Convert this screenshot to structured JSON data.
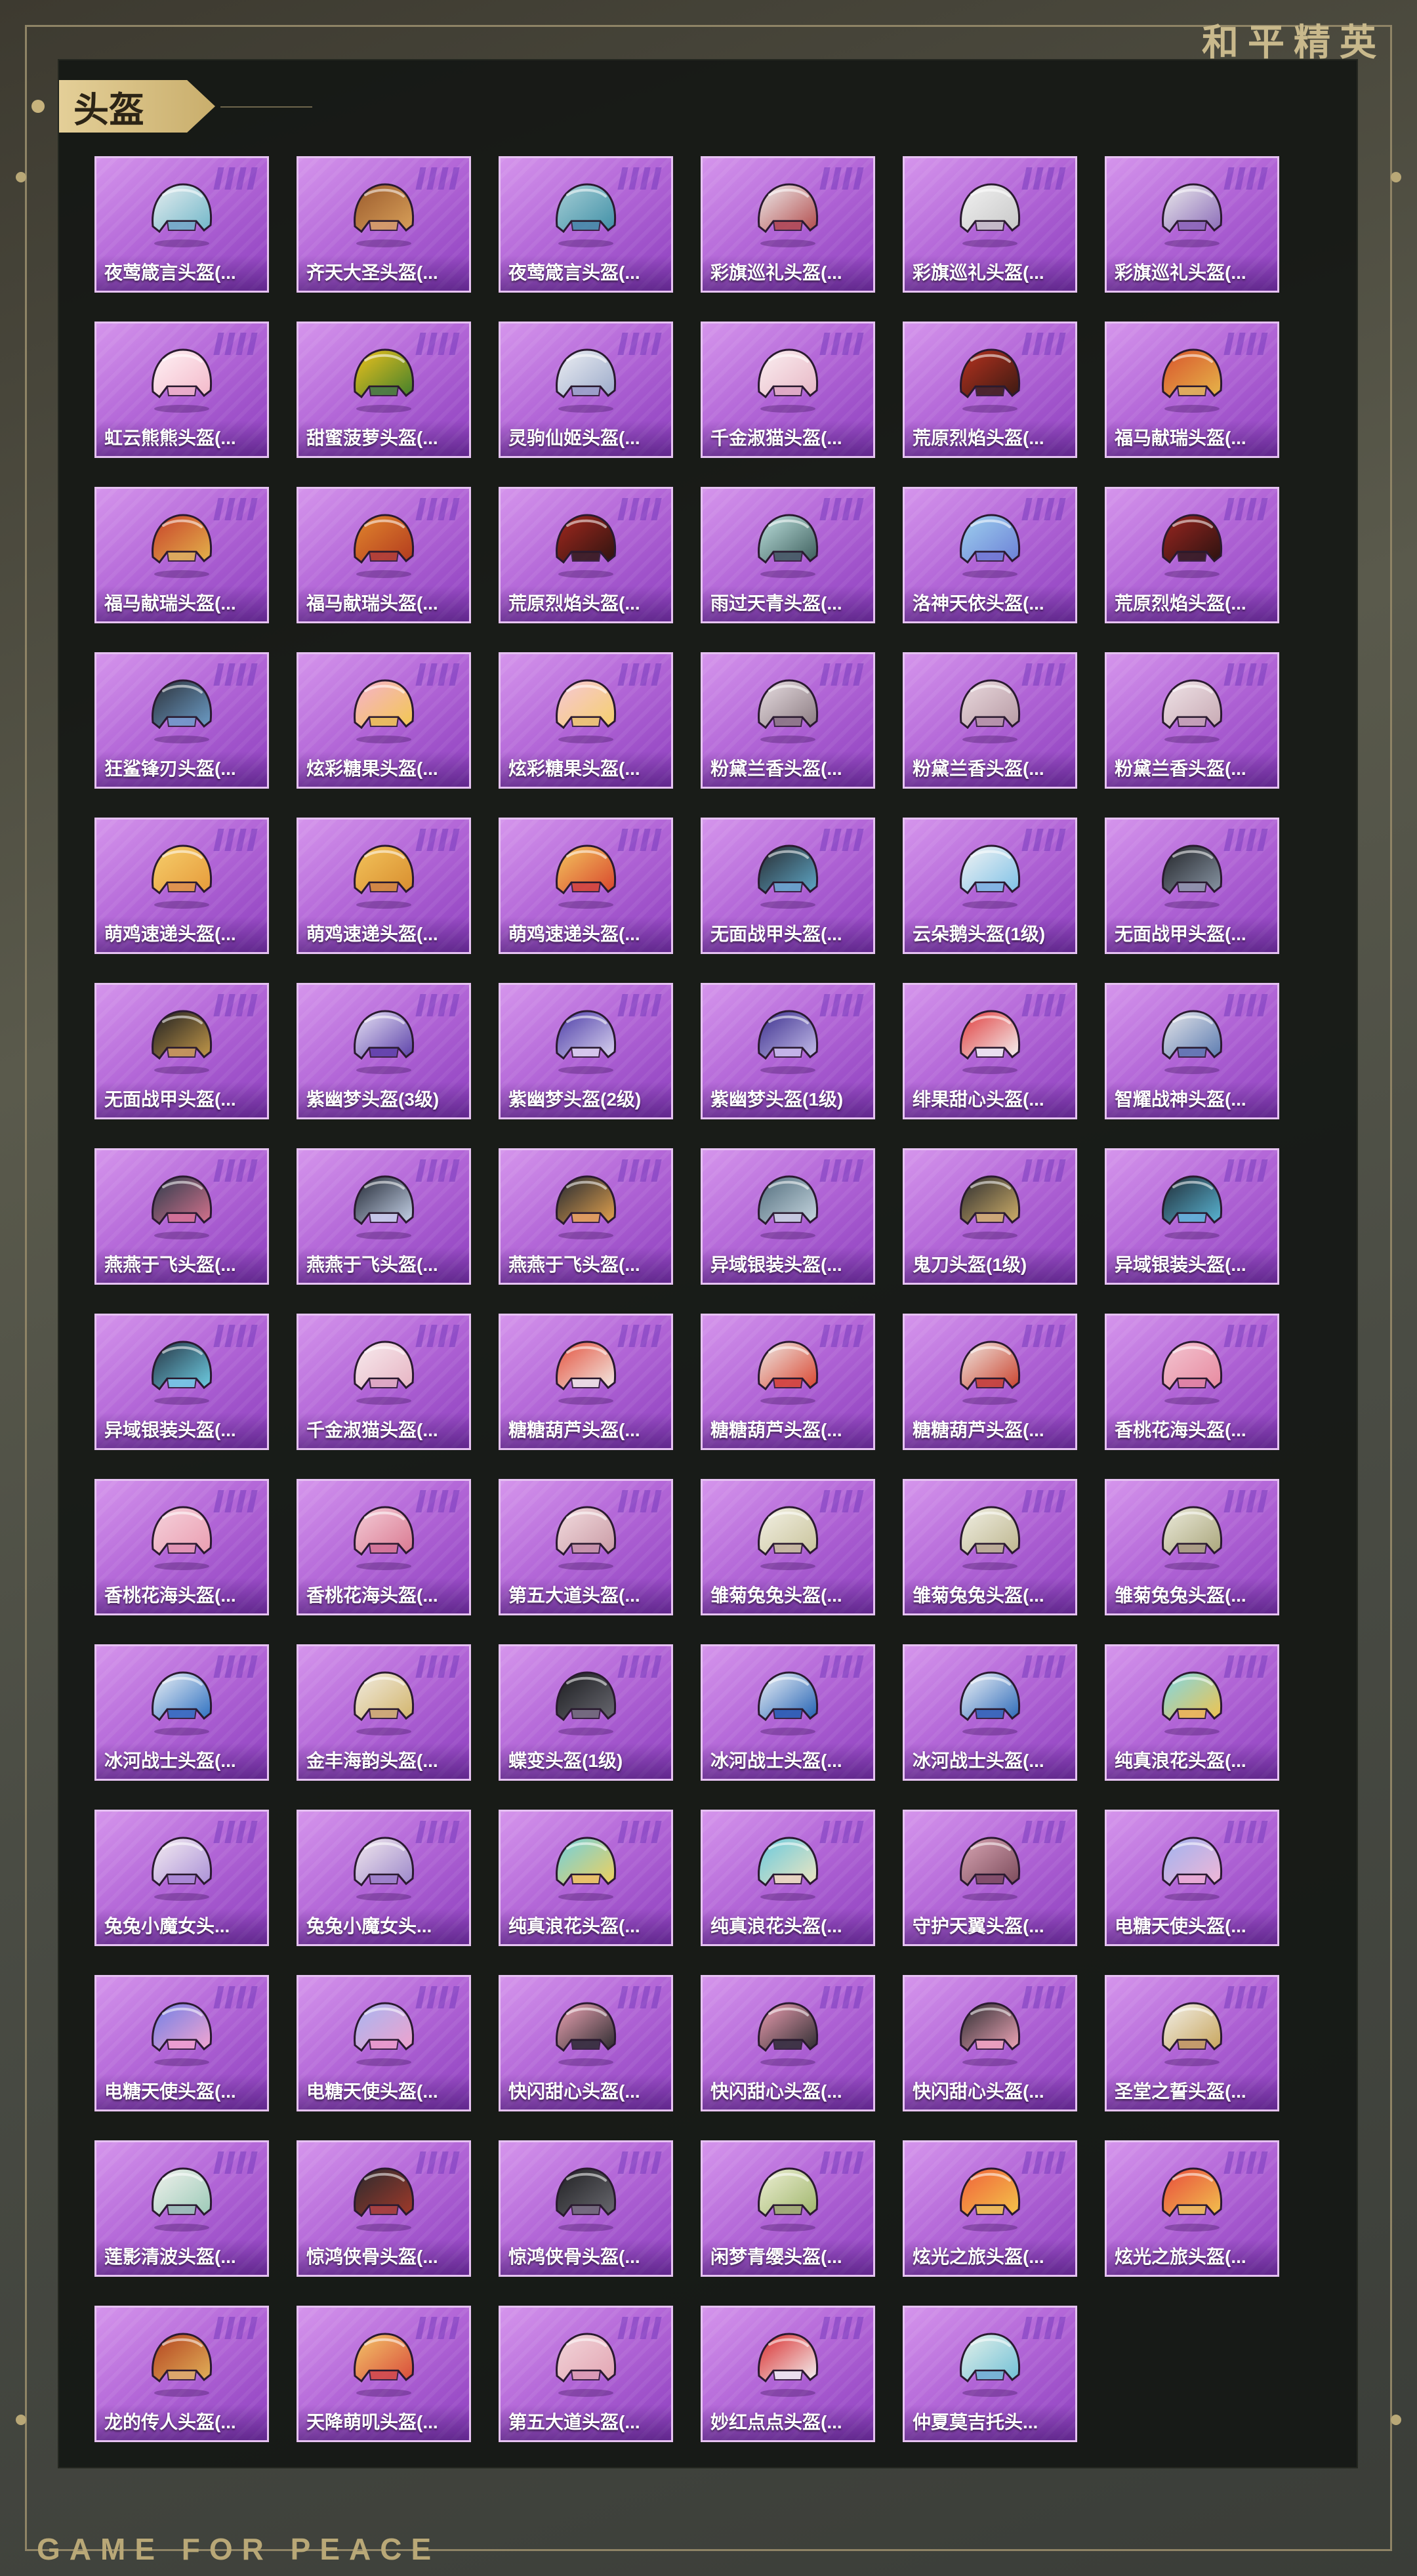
{
  "brand": "和平精英",
  "section_title": "头盔",
  "footer": "GAME FOR PEACE",
  "items": [
    {
      "name": "夜莺箴言头盔(...",
      "c1": "#e8eef0",
      "c2": "#6fb6c8"
    },
    {
      "name": "齐天大圣头盔(...",
      "c1": "#9a5a2c",
      "c2": "#d9a15a"
    },
    {
      "name": "夜莺箴言头盔(...",
      "c1": "#a7cfd6",
      "c2": "#3f8fa6"
    },
    {
      "name": "彩旗巡礼头盔(...",
      "c1": "#eeeeee",
      "c2": "#b24a4a"
    },
    {
      "name": "彩旗巡礼头盔(...",
      "c1": "#f2f2f2",
      "c2": "#c7c7c7"
    },
    {
      "name": "彩旗巡礼头盔(...",
      "c1": "#ececec",
      "c2": "#8a6ab8"
    },
    {
      "name": "虹云熊熊头盔(...",
      "c1": "#fff3f6",
      "c2": "#f3b8c9"
    },
    {
      "name": "甜蜜菠萝头盔(...",
      "c1": "#f1c21c",
      "c2": "#3f7f2c"
    },
    {
      "name": "灵驹仙姬头盔(...",
      "c1": "#eef0f4",
      "c2": "#9aa9c9"
    },
    {
      "name": "千金淑猫头盔(...",
      "c1": "#fbf0f2",
      "c2": "#e7b6c4"
    },
    {
      "name": "荒原烈焰头盔(...",
      "c1": "#b8321f",
      "c2": "#3a1a12"
    },
    {
      "name": "福马献瑞头盔(...",
      "c1": "#d8532c",
      "c2": "#e6b64a"
    },
    {
      "name": "福马献瑞头盔(...",
      "c1": "#c7402a",
      "c2": "#e4b44b"
    },
    {
      "name": "福马献瑞头盔(...",
      "c1": "#e2872d",
      "c2": "#b23a1e"
    },
    {
      "name": "荒原烈焰头盔(...",
      "c1": "#a5281e",
      "c2": "#2d1410"
    },
    {
      "name": "雨过天青头盔(...",
      "c1": "#bfe3e0",
      "c2": "#3b5c5a"
    },
    {
      "name": "洛神天依头盔(...",
      "c1": "#9fd2ef",
      "c2": "#6b7fd6"
    },
    {
      "name": "荒原烈焰头盔(...",
      "c1": "#9c2620",
      "c2": "#2a1210"
    },
    {
      "name": "狂鲨锋刃头盔(...",
      "c1": "#2b3038",
      "c2": "#6d9ec9"
    },
    {
      "name": "炫彩糖果头盔(...",
      "c1": "#f6b2cf",
      "c2": "#f2c84e"
    },
    {
      "name": "炫彩糖果头盔(...",
      "c1": "#f7c7d8",
      "c2": "#f4d06a"
    },
    {
      "name": "粉黛兰香头盔(...",
      "c1": "#e9dfe3",
      "c2": "#8a7a80"
    },
    {
      "name": "粉黛兰香头盔(...",
      "c1": "#eadade",
      "c2": "#b79aa4"
    },
    {
      "name": "粉黛兰香头盔(...",
      "c1": "#f0e4e8",
      "c2": "#c7a9b3"
    },
    {
      "name": "萌鸡速递头盔(...",
      "c1": "#f6cf6c",
      "c2": "#e69a3a"
    },
    {
      "name": "萌鸡速递头盔(...",
      "c1": "#f3c45c",
      "c2": "#d88d2e"
    },
    {
      "name": "萌鸡速递头盔(...",
      "c1": "#f4c75f",
      "c2": "#d8442c"
    },
    {
      "name": "无面战甲头盔(...",
      "c1": "#26292e",
      "c2": "#5fa9c9"
    },
    {
      "name": "云朵鹅头盔(1级)",
      "c1": "#f4f4f4",
      "c2": "#7cc0e6"
    },
    {
      "name": "无面战甲头盔(...",
      "c1": "#202226",
      "c2": "#8a97a6"
    },
    {
      "name": "无面战甲头盔(...",
      "c1": "#1c1d20",
      "c2": "#c59a4a"
    },
    {
      "name": "紫幽梦头盔(3级)",
      "c1": "#e9e5f6",
      "c2": "#5a3fa8"
    },
    {
      "name": "紫幽梦头盔(2级)",
      "c1": "#4a3aa6",
      "c2": "#dcd6f1"
    },
    {
      "name": "紫幽梦头盔(1级)",
      "c1": "#3a2d8c",
      "c2": "#c7c0ec"
    },
    {
      "name": "绯果甜心头盔(...",
      "c1": "#e03a3a",
      "c2": "#f4f4f4"
    },
    {
      "name": "智耀战神头盔(...",
      "c1": "#e7e7ea",
      "c2": "#5a7ab0"
    },
    {
      "name": "燕燕于飞头盔(...",
      "c1": "#2b3a4a",
      "c2": "#d6738e"
    },
    {
      "name": "燕燕于飞头盔(...",
      "c1": "#1e2430",
      "c2": "#c9d6ec"
    },
    {
      "name": "燕燕于飞头盔(...",
      "c1": "#1f2530",
      "c2": "#e6a44e"
    },
    {
      "name": "异域银装头盔(...",
      "c1": "#4f6a7a",
      "c2": "#c9d9e2"
    },
    {
      "name": "鬼刀头盔(1级)",
      "c1": "#2a2a2e",
      "c2": "#d2b26a"
    },
    {
      "name": "异域银装头盔(...",
      "c1": "#1f2a34",
      "c2": "#5ab7d6"
    },
    {
      "name": "异域银装头盔(...",
      "c1": "#243140",
      "c2": "#6fd0e6"
    },
    {
      "name": "千金淑猫头盔(...",
      "c1": "#f8ecef",
      "c2": "#e6b3c2"
    },
    {
      "name": "糖糖葫芦头盔(...",
      "c1": "#e3503c",
      "c2": "#f3ece6"
    },
    {
      "name": "糖糖葫芦头盔(...",
      "c1": "#eeeae6",
      "c2": "#d9442e"
    },
    {
      "name": "糖糖葫芦头盔(...",
      "c1": "#f0e8e2",
      "c2": "#c9412c"
    },
    {
      "name": "香桃花海头盔(...",
      "c1": "#f3c6d2",
      "c2": "#e7899f"
    },
    {
      "name": "香桃花海头盔(...",
      "c1": "#f5d2dc",
      "c2": "#ea9db0"
    },
    {
      "name": "香桃花海头盔(...",
      "c1": "#f4cdd8",
      "c2": "#d97890"
    },
    {
      "name": "第五大道头盔(...",
      "c1": "#f3dde0",
      "c2": "#c99aa4"
    },
    {
      "name": "雏菊兔兔头盔(...",
      "c1": "#f3f1e6",
      "c2": "#c9c39a"
    },
    {
      "name": "雏菊兔兔头盔(...",
      "c1": "#f1efe4",
      "c2": "#bdb68e"
    },
    {
      "name": "雏菊兔兔头盔(...",
      "c1": "#ecebdc",
      "c2": "#a9a57a"
    },
    {
      "name": "冰河战士头盔(...",
      "c1": "#eef2f6",
      "c2": "#2c6fc0"
    },
    {
      "name": "金丰海韵头盔(...",
      "c1": "#f1ece2",
      "c2": "#d2b46a"
    },
    {
      "name": "蝶变头盔(1级)",
      "c1": "#1a1b1e",
      "c2": "#6a6a72"
    },
    {
      "name": "冰河战士头盔(...",
      "c1": "#f0f4f8",
      "c2": "#1f5fb2"
    },
    {
      "name": "冰河战士头盔(...",
      "c1": "#f2f5f8",
      "c2": "#2a68b8"
    },
    {
      "name": "纯真浪花头盔(...",
      "c1": "#7fd7e6",
      "c2": "#f1c34c"
    },
    {
      "name": "兔兔小魔女头...",
      "c1": "#f6eef2",
      "c2": "#a98fd6"
    },
    {
      "name": "兔兔小魔女头...",
      "c1": "#f3eaef",
      "c2": "#9b86c9"
    },
    {
      "name": "纯真浪花头盔(...",
      "c1": "#6fd0e0",
      "c2": "#f2d05a"
    },
    {
      "name": "纯真浪花头盔(...",
      "c1": "#66c9de",
      "c2": "#f1e6c0"
    },
    {
      "name": "守护天翼头盔(...",
      "c1": "#d9a6b4",
      "c2": "#7a4a5a"
    },
    {
      "name": "电糖天使头盔(...",
      "c1": "#9fb3f0",
      "c2": "#f2b6d6"
    },
    {
      "name": "电糖天使头盔(...",
      "c1": "#6f7fe6",
      "c2": "#f5a6d0"
    },
    {
      "name": "电糖天使头盔(...",
      "c1": "#a6b6f2",
      "c2": "#f0a2cc"
    },
    {
      "name": "快闪甜心头盔(...",
      "c1": "#f0a6b6",
      "c2": "#2a2a2e"
    },
    {
      "name": "快闪甜心头盔(...",
      "c1": "#ee9fb2",
      "c2": "#2c2c30"
    },
    {
      "name": "快闪甜心头盔(...",
      "c1": "#2a2a2e",
      "c2": "#f2a8ba"
    },
    {
      "name": "圣堂之誓头盔(...",
      "c1": "#f2f0ea",
      "c2": "#c7a45a"
    },
    {
      "name": "莲影清波头盔(...",
      "c1": "#f2f2ee",
      "c2": "#9ac9b6"
    },
    {
      "name": "惊鸿侠骨头盔(...",
      "c1": "#2a2a2e",
      "c2": "#a23a2a"
    },
    {
      "name": "惊鸿侠骨头盔(...",
      "c1": "#1f1f22",
      "c2": "#6a6a70"
    },
    {
      "name": "闲梦青缨头盔(...",
      "c1": "#eef0d6",
      "c2": "#9fb56a"
    },
    {
      "name": "炫光之旅头盔(...",
      "c1": "#f0603a",
      "c2": "#f4c64a"
    },
    {
      "name": "炫光之旅头盔(...",
      "c1": "#e84a3c",
      "c2": "#f2c24e"
    },
    {
      "name": "龙的传人头盔(...",
      "c1": "#b2401e",
      "c2": "#e2b25a"
    },
    {
      "name": "天降萌叽头盔(...",
      "c1": "#f4c86a",
      "c2": "#d84a3a"
    },
    {
      "name": "第五大道头盔(...",
      "c1": "#f2d6da",
      "c2": "#e2a4b2"
    },
    {
      "name": "妙红点点头盔(...",
      "c1": "#d82a2a",
      "c2": "#f4f4f4"
    },
    {
      "name": "仲夏莫吉托头...",
      "c1": "#e6f2ea",
      "c2": "#6fbfd6"
    }
  ]
}
